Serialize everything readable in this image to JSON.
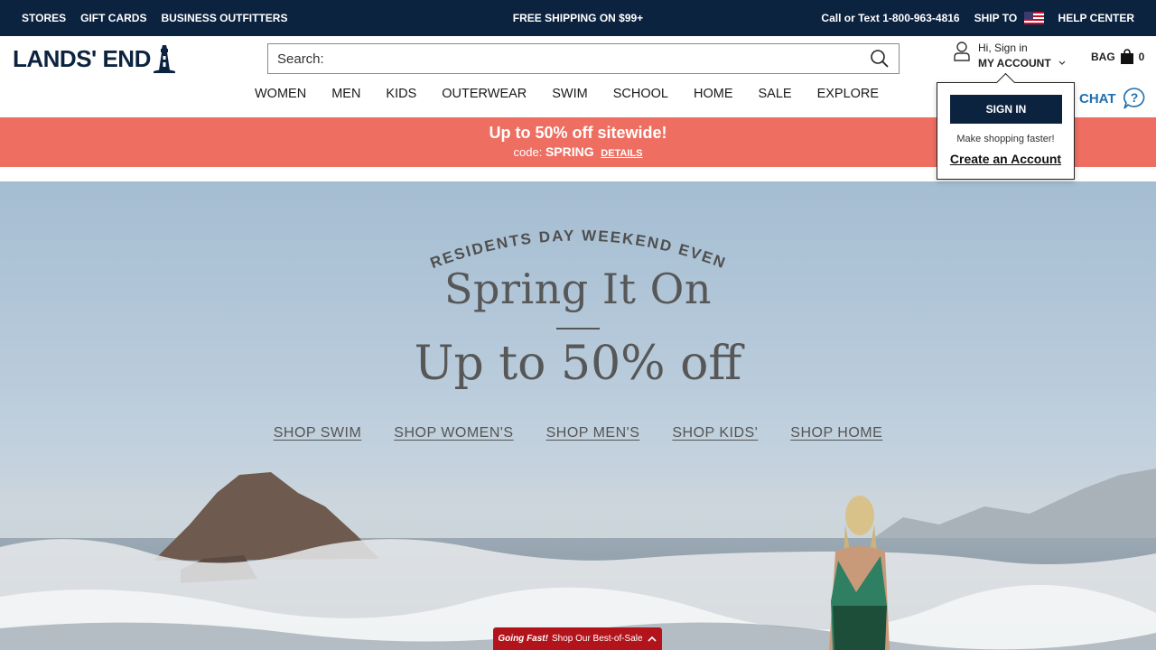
{
  "utility": {
    "links_left": [
      "STORES",
      "GIFT CARDS",
      "BUSINESS OUTFITTERS"
    ],
    "center": "FREE SHIPPING ON $99+",
    "phone": "Call or Text 1-800-963-4816",
    "ship_to": "SHIP TO",
    "help": "HELP CENTER",
    "flag_icon": "us-flag-icon"
  },
  "brand": {
    "logo_text": "LANDS' END",
    "logo_icon": "lighthouse-icon",
    "color": "#0c2340"
  },
  "search": {
    "placeholder": "Search:",
    "icon": "search-icon"
  },
  "account": {
    "greeting": "Hi, Sign in",
    "label": "MY ACCOUNT",
    "icon": "user-icon"
  },
  "bag": {
    "label": "BAG",
    "count": "0",
    "icon": "shopping-bag-icon"
  },
  "nav": [
    "WOMEN",
    "MEN",
    "KIDS",
    "OUTERWEAR",
    "SWIM",
    "SCHOOL",
    "HOME",
    "SALE",
    "EXPLORE"
  ],
  "chat": {
    "label": "CHAT",
    "icon": "help-circle-icon",
    "color": "#1f6fb0"
  },
  "promo": {
    "headline": "Up to 50% off sitewide!",
    "code_prefix": "code:",
    "code": "SPRING",
    "details": "DETAILS",
    "background": "#ee6e62"
  },
  "hero": {
    "arc_text": "PRESIDENTS DAY WEEKEND EVENT",
    "title": "Spring It On",
    "subtitle": "Up to 50% off",
    "links": [
      "SHOP SWIM",
      "SHOP WOMEN'S",
      "SHOP MEN'S",
      "SHOP KIDS'",
      "SHOP HOME"
    ]
  },
  "account_dropdown": {
    "sign_in": "SIGN IN",
    "hint": "Make shopping faster!",
    "create": "Create an Account"
  },
  "going_fast": {
    "bold": "Going Fast!",
    "text": "Shop Our Best-of-Sale",
    "icon": "chevron-up-icon",
    "color": "#b3141b"
  }
}
